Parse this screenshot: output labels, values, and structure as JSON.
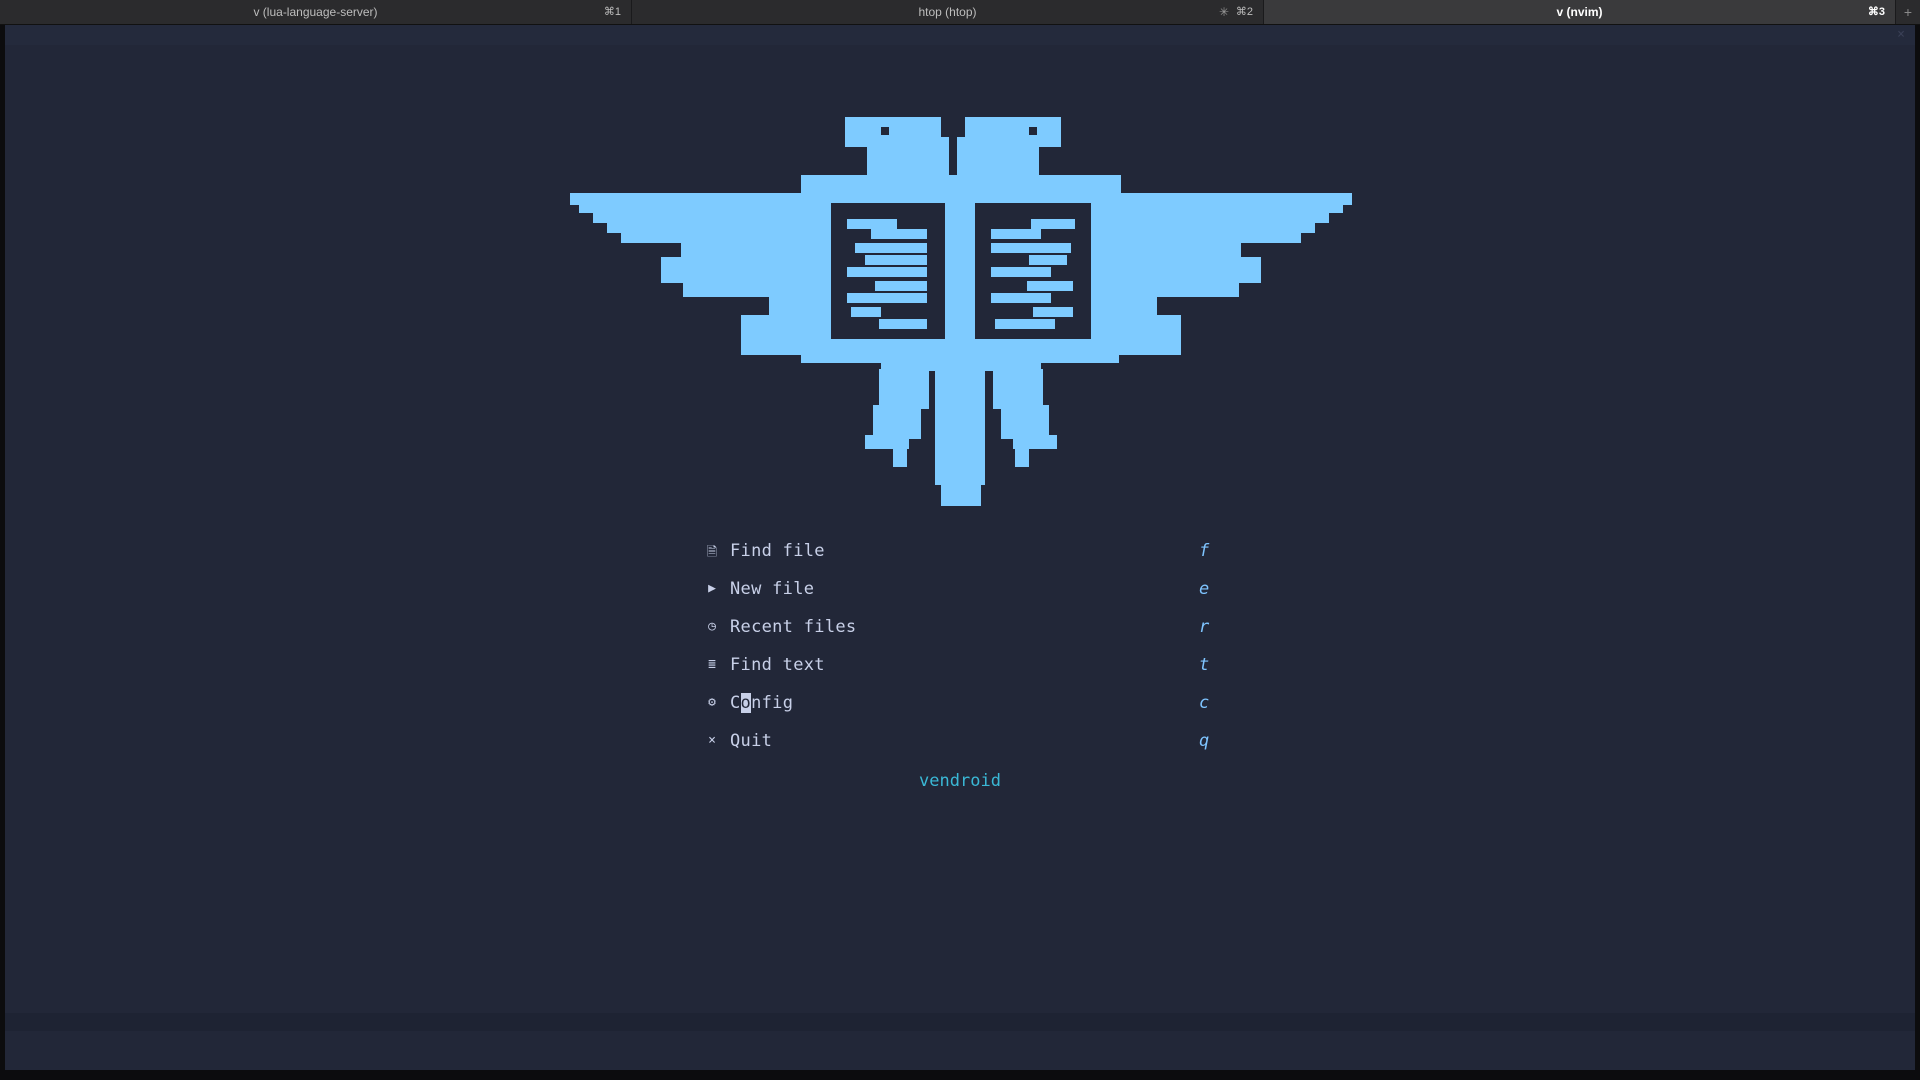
{
  "tabs": [
    {
      "title": "v (lua-language-server)",
      "shortcut": "⌘1"
    },
    {
      "title": "htop (htop)",
      "shortcut": "⌘2"
    },
    {
      "title": "v (nvim)",
      "shortcut": "⌘3"
    }
  ],
  "tab_new_label": "+",
  "editor": {
    "close_glyph": "×"
  },
  "logo": {
    "icon": "double-headed-eagle-with-book-icon",
    "color": "#7ecbff"
  },
  "menu": [
    {
      "icon": "file-icon",
      "glyph": "🗎",
      "label": "Find file",
      "key": "f"
    },
    {
      "icon": "play-icon",
      "glyph": "▶",
      "label": "New file",
      "key": "e"
    },
    {
      "icon": "clock-icon",
      "glyph": "◷",
      "label": "Recent files",
      "key": "r"
    },
    {
      "icon": "lines-icon",
      "glyph": "≣",
      "label": "Find text",
      "key": "t"
    },
    {
      "icon": "gear-icon",
      "glyph": "⚙",
      "label_before_cursor": "C",
      "label_cursor": "o",
      "label_after_cursor": "nfig",
      "key": "c"
    },
    {
      "icon": "close-icon",
      "glyph": "×",
      "label": "Quit",
      "key": "q"
    }
  ],
  "footer": "vendroid",
  "colors": {
    "background": "#222738",
    "menu_text": "#c8d0e8",
    "shortcut_key": "#7ec4ff",
    "footer": "#3ab8d6"
  }
}
